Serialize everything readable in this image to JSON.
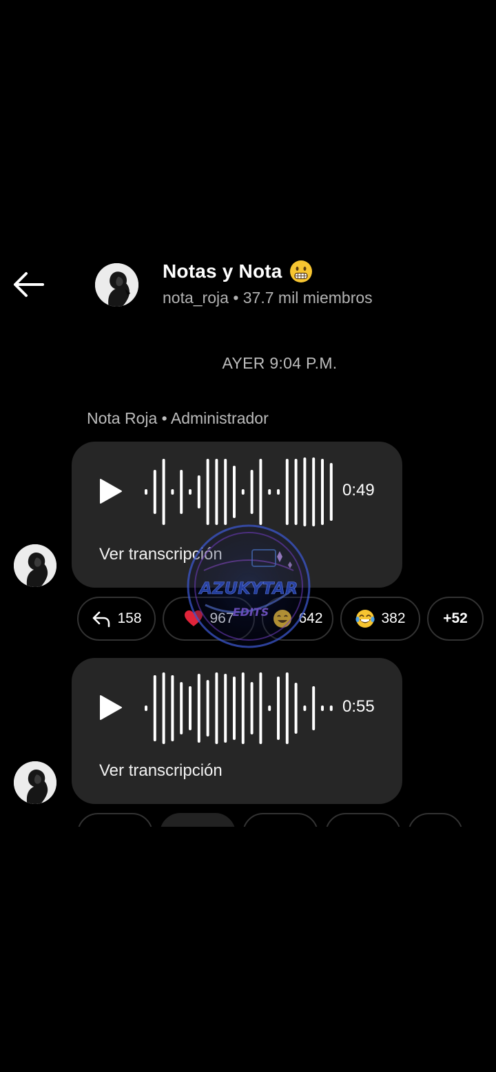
{
  "header": {
    "back_icon": "arrow-left-icon",
    "title": "Notas y Nota",
    "title_emoji": "grimacing-face-emoji",
    "handle": "nota_roja",
    "separator": "•",
    "members": "37.7 mil miembros"
  },
  "date_separator": "AYER 9:04 P.M.",
  "sender": {
    "name": "Nota Roja",
    "separator": "•",
    "role": "Administrador"
  },
  "messages": [
    {
      "type": "voice",
      "duration": "0:49",
      "transcript_label": "Ver transcripción",
      "reactions": [
        {
          "icon": "reply-icon",
          "count": "158"
        },
        {
          "icon": "red-heart-emoji",
          "count": "967"
        },
        {
          "icon": "emoji-face",
          "count": "642"
        },
        {
          "icon": "tears-of-joy-emoji",
          "count": "382"
        },
        {
          "icon": "more",
          "count": "+52"
        }
      ]
    },
    {
      "type": "voice",
      "duration": "0:55",
      "transcript_label": "Ver transcripción"
    }
  ],
  "watermark": {
    "line1": "AZUKYTAR",
    "line2": "EDITS"
  },
  "colors": {
    "background": "#000000",
    "bubble": "#262626",
    "muted_text": "#bdbdbd",
    "pill_border": "#333333",
    "heart": "#e0243a",
    "emoji_yellow": "#f7c531"
  }
}
